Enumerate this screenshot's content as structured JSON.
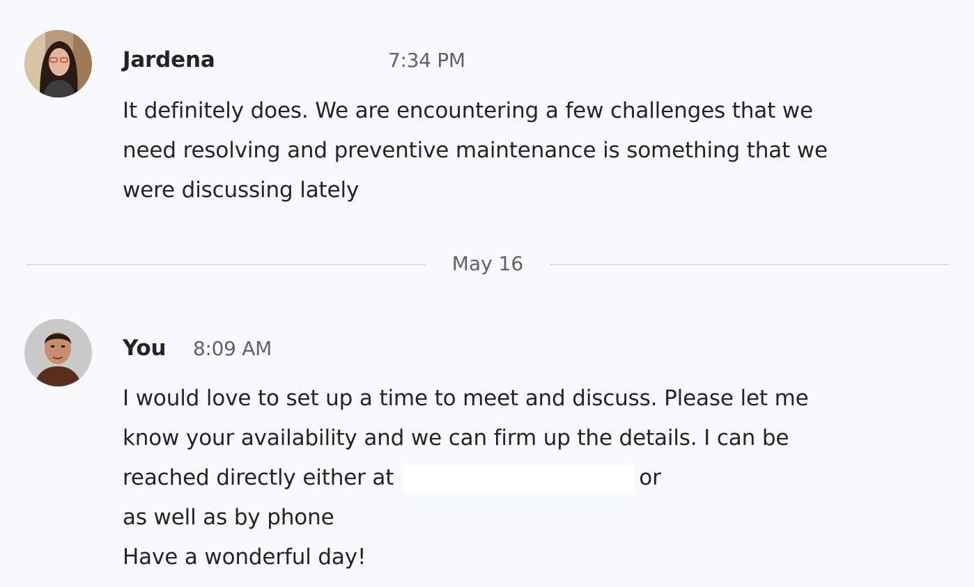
{
  "messages": [
    {
      "sender": "Jardena",
      "time": "7:34 PM",
      "avatar": "avatar-woman",
      "lines": [
        "It definitely does. We are encountering a few challenges that we",
        "need resolving and preventive maintenance is something that we",
        "were discussing lately"
      ]
    },
    {
      "sender": "You",
      "time": "8:09 AM",
      "avatar": "avatar-man",
      "lines": [
        "I would love to set up a time to meet and discuss. Please let me",
        "know your availability and we can firm up the details. I can be",
        "reached directly either at",
        "or",
        "as well as by phone",
        "Have a wonderful day!"
      ]
    }
  ],
  "date_divider": "May 16",
  "colors": {
    "background": "#f8f9fc",
    "text": "#242424",
    "muted": "#616161",
    "rule": "#dcdde2"
  }
}
